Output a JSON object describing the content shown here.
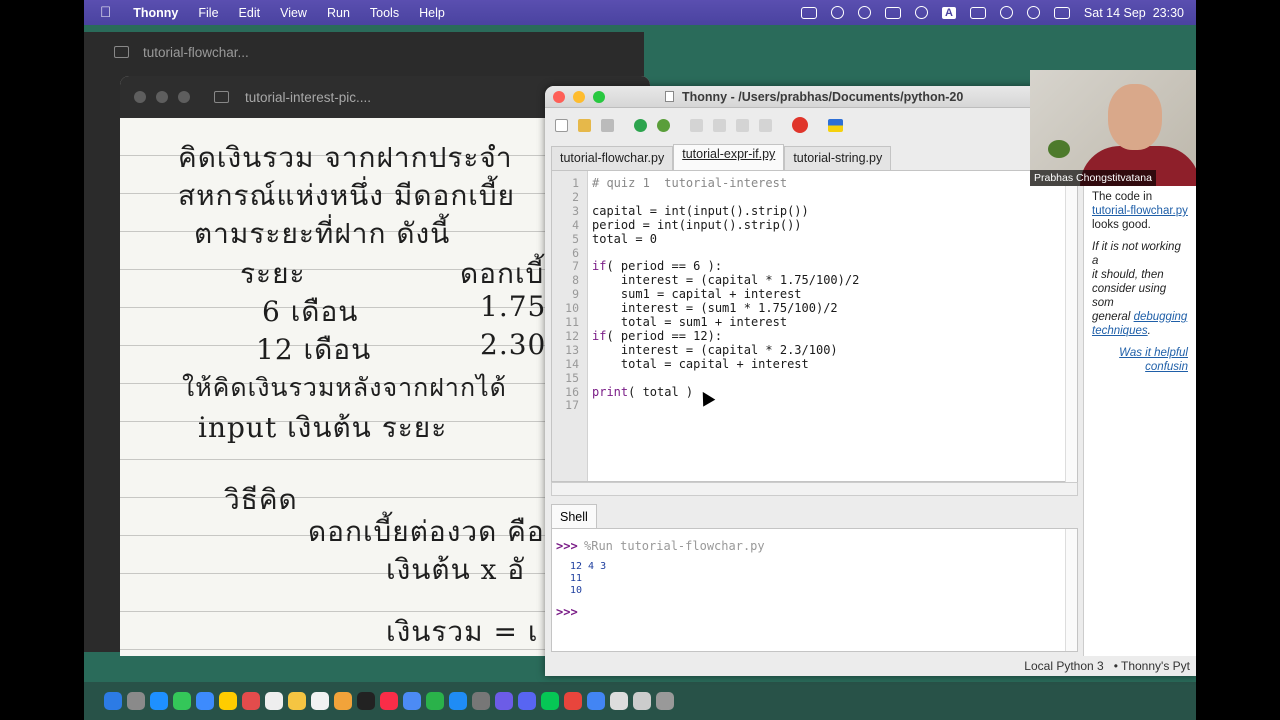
{
  "menubar": {
    "app_name": "Thonny",
    "items": [
      "File",
      "Edit",
      "View",
      "Run",
      "Tools",
      "Help"
    ],
    "input_source": "A",
    "datetime": "Sat 14 Sep  23:30"
  },
  "back_window": {
    "title": "tutorial-flowchar..."
  },
  "preview_window": {
    "title": "tutorial-interest-pic....",
    "handwriting": [
      "คิดเงินรวม จากฝากประจำ",
      "สหกรณ์แห่งหนึ่ง มีดอกเบี้ย",
      "ตามระยะที่ฝาก ดังนี้",
      "ระยะ",
      "ดอกเบี้ย",
      "6 เดือน",
      "1.75",
      "12 เดือน",
      "2.30",
      "ให้คิดเงินรวมหลังจากฝากได้",
      "input เงินต้น ระยะ",
      "วิธีคิด",
      "ดอกเบี้ยต่องวด คือ",
      "เงินต้น x อั",
      "เงินรวม = เ"
    ]
  },
  "thonny": {
    "title": "Thonny  -  /Users/prabhas/Documents/python-20",
    "tabs": [
      "tutorial-flowchar.py",
      "tutorial-expr-if.py",
      "tutorial-string.py"
    ],
    "active_tab": "tutorial-expr-if.py",
    "code_lines": [
      "# quiz 1  tutorial-interest",
      "",
      "capital = int(input().strip())",
      "period = int(input().strip())",
      "total = 0",
      "",
      "if( period == 6 ):",
      "    interest = (capital * 1.75/100)/2",
      "    sum1 = capital + interest",
      "    interest = (sum1 * 1.75/100)/2",
      "    total = sum1 + interest",
      "if( period == 12):",
      "    interest = (capital * 2.3/100)",
      "    total = capital + interest",
      "",
      "print( total )",
      ""
    ],
    "line_numbers": [
      "1",
      "2",
      "3",
      "4",
      "5",
      "6",
      "7",
      "8",
      "9",
      "10",
      "11",
      "12",
      "13",
      "14",
      "15",
      "16",
      "17"
    ],
    "shell_label": "Shell",
    "shell": {
      "prompt": ">>>",
      "command": "%Run tutorial-flowchar.py",
      "output": [
        "12 4 3",
        "11",
        "10"
      ]
    },
    "assistant": {
      "line1": "The code in",
      "file_link": "tutorial-flowchar.py",
      "line2": "looks good.",
      "para2a": "If it is not working a",
      "para2b": "it should, then",
      "para2c": "consider using som",
      "para2d": "general",
      "para2_link1": "debugging",
      "para2_link2": "techniques",
      "helpful_a": "Was it helpful",
      "helpful_b": "confusin"
    },
    "status": {
      "interpreter": "Local Python 3",
      "extra": "•  Thonny's Pyt"
    }
  },
  "webcam": {
    "name": "Prabhas Chongstitvatana"
  },
  "colors": {
    "keyword": "#7a1d87",
    "prompt": "#7a1d87",
    "link": "#1f5fa8",
    "output": "#1f3f9f"
  }
}
